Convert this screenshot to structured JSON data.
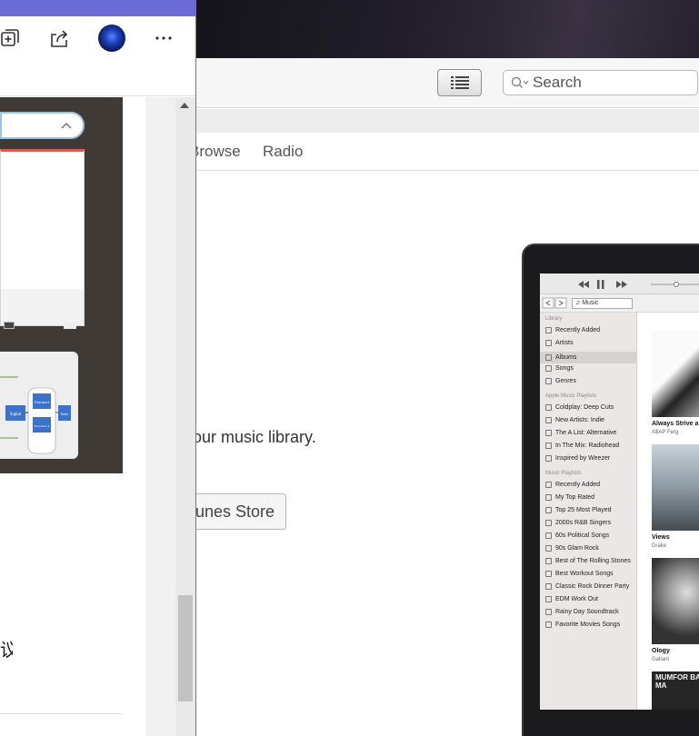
{
  "itunes": {
    "search_placeholder": "Search",
    "nav_tabs": [
      "Browse",
      "Radio"
    ],
    "body_text": "our music library.",
    "store_button": "unes Store",
    "screen": {
      "dropdown": "Music",
      "library_header": "Library",
      "library_items": [
        "Recently Added",
        "Artists",
        "Albums",
        "Songs",
        "Genres"
      ],
      "selected_library_item": "Albums",
      "apple_playlists_header": "Apple Music Playlists",
      "apple_playlists": [
        "Coldplay: Deep Cuts",
        "New Artists: Indie",
        "The A List: Alternative",
        "In The Mix: Radiohead",
        "Inspired by Weezer"
      ],
      "music_playlists_header": "Music Playlists",
      "music_playlists": [
        "Recently Added",
        "My Top Rated",
        "Top 25 Most Played",
        "2000s R&B Singers",
        "60s Political Songs",
        "90s Glam Rock",
        "Best of The Rolling Stones",
        "Best Workout Songs",
        "Classic Rock Dinner Party",
        "EDM Work Out",
        "Rainy Day Soundtrack",
        "Favorite Movies Songs"
      ],
      "albums": [
        {
          "title": "Always Strive a",
          "artist": "A$AP Ferg"
        },
        {
          "title": "Views",
          "artist": "Drake"
        },
        {
          "title": "Ology",
          "artist": "Gallant"
        }
      ],
      "album4_cover_text": "MUMFOR BABBA MA"
    }
  },
  "edge": {
    "cjk_fragment": "议",
    "diagram_labels": [
      "Sigbal",
      "Transport",
      "Evolution 2",
      "Rate"
    ]
  },
  "colors": {
    "edge_accent": "#6b6bd6",
    "panel_red": "#e0584e",
    "pill_border": "#9fc3e6"
  }
}
